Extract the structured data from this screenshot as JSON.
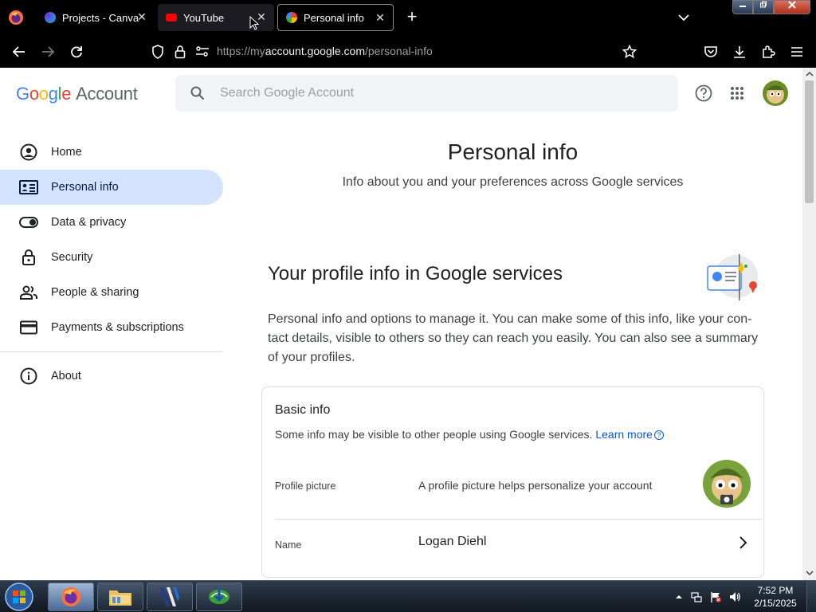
{
  "browser": {
    "tabs": [
      {
        "title": "Projects - Canva",
        "favicon": "canva-icon",
        "active": false
      },
      {
        "title": "YouTube",
        "favicon": "youtube-icon",
        "active": false
      },
      {
        "title": "Personal info",
        "favicon": "google-icon",
        "active": true
      }
    ],
    "close_glyph": "✕",
    "new_tab_glyph": "+",
    "url": {
      "scheme": "https://my",
      "host": "account.google.com",
      "path": "/personal-info"
    }
  },
  "header": {
    "logo": {
      "g": "G",
      "o1": "o",
      "o2": "o",
      "g2": "g",
      "l": "l",
      "e": "e",
      "account": "Account"
    },
    "search_placeholder": "Search Google Account"
  },
  "sidebar": {
    "items": [
      {
        "label": "Home",
        "icon": "account-circle-icon"
      },
      {
        "label": "Personal info",
        "icon": "id-card-icon",
        "active": true
      },
      {
        "label": "Data & privacy",
        "icon": "toggle-icon"
      },
      {
        "label": "Security",
        "icon": "lock-icon"
      },
      {
        "label": "People & sharing",
        "icon": "people-icon"
      },
      {
        "label": "Payments & subscriptions",
        "icon": "credit-card-icon"
      }
    ],
    "about": {
      "label": "About",
      "icon": "info-icon"
    }
  },
  "main": {
    "title": "Personal info",
    "subtitle": "Info about you and your preferences across Google services",
    "section_title": "Your profile info in Google services",
    "section_desc_1": "Personal info and options to manage it. You can make some of this info, like your con-",
    "section_desc_2": "tact details, visible to others so they can reach you easily. You can also see a summary",
    "section_desc_3": "of your profiles.",
    "card": {
      "title": "Basic info",
      "subtitle": "Some info may be visible to other people using Google services.",
      "learn_more": "Learn more",
      "help_glyph": "?",
      "rows": [
        {
          "label": "Profile picture",
          "value": "A profile picture helps personalize your account"
        },
        {
          "label": "Name",
          "value": "Logan Diehl"
        }
      ]
    }
  },
  "taskbar": {
    "time": "7:52 PM",
    "date": "2/15/2025"
  },
  "colors": {
    "accent": "#0b57d0",
    "active_nav": "#d3e3fd"
  }
}
